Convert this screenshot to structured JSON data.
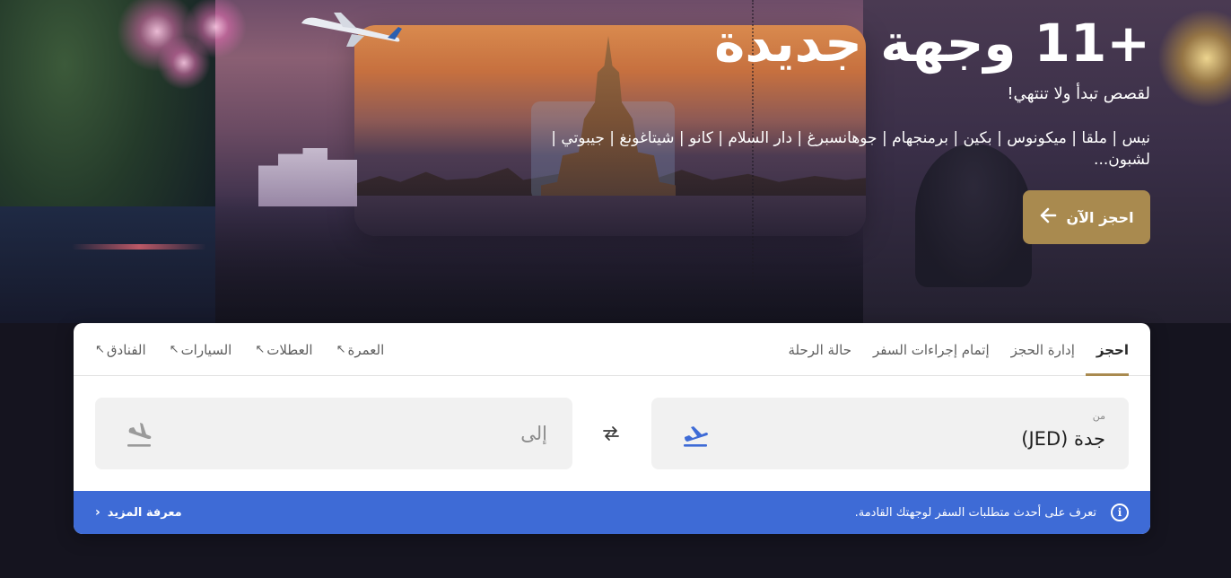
{
  "hero": {
    "title": "+11 وجهة جديدة",
    "subtitle": "لقصص تبدأ ولا تنتهي!",
    "destinations": "نيس | ملقا | ميكونوس | بكين | برمنجهام | جوهانسبرغ | دار السلام | كانو | شيتاغونغ | جيبوتي | لشبون...",
    "book_now_label": "احجز الآن",
    "book_now_icon": "arrow-left-icon"
  },
  "tabs": {
    "main": [
      {
        "label": "احجز",
        "active": true
      },
      {
        "label": "إدارة الحجز",
        "active": false
      },
      {
        "label": "إتمام إجراءات السفر",
        "active": false
      },
      {
        "label": "حالة الرحلة",
        "active": false
      }
    ],
    "services": [
      {
        "label": "الفنادق",
        "icon": "external-link-icon"
      },
      {
        "label": "السيارات",
        "icon": "external-link-icon"
      },
      {
        "label": "العطلات",
        "icon": "external-link-icon"
      },
      {
        "label": "العمرة",
        "icon": "external-link-icon"
      }
    ],
    "external_glyph": "↖"
  },
  "search": {
    "from": {
      "label": "من",
      "value": "جدة (JED)",
      "icon": "plane-takeoff-icon"
    },
    "to": {
      "placeholder": "إلى",
      "icon": "plane-landing-icon"
    },
    "swap_icon": "swap-arrows-icon"
  },
  "info_bar": {
    "text": "تعرف على أحدث متطلبات السفر لوجهتك القادمة.",
    "icon": "info-icon",
    "icon_glyph": "i",
    "learn_more_label": "معرفة المزيد",
    "learn_more_glyph": "‹"
  },
  "colors": {
    "accent_gold": "#a98a4f",
    "info_blue": "#3e6bd6",
    "takeoff_icon": "#3e6bd6",
    "landing_icon": "#9a9a9a",
    "page_background": "#15141f"
  }
}
